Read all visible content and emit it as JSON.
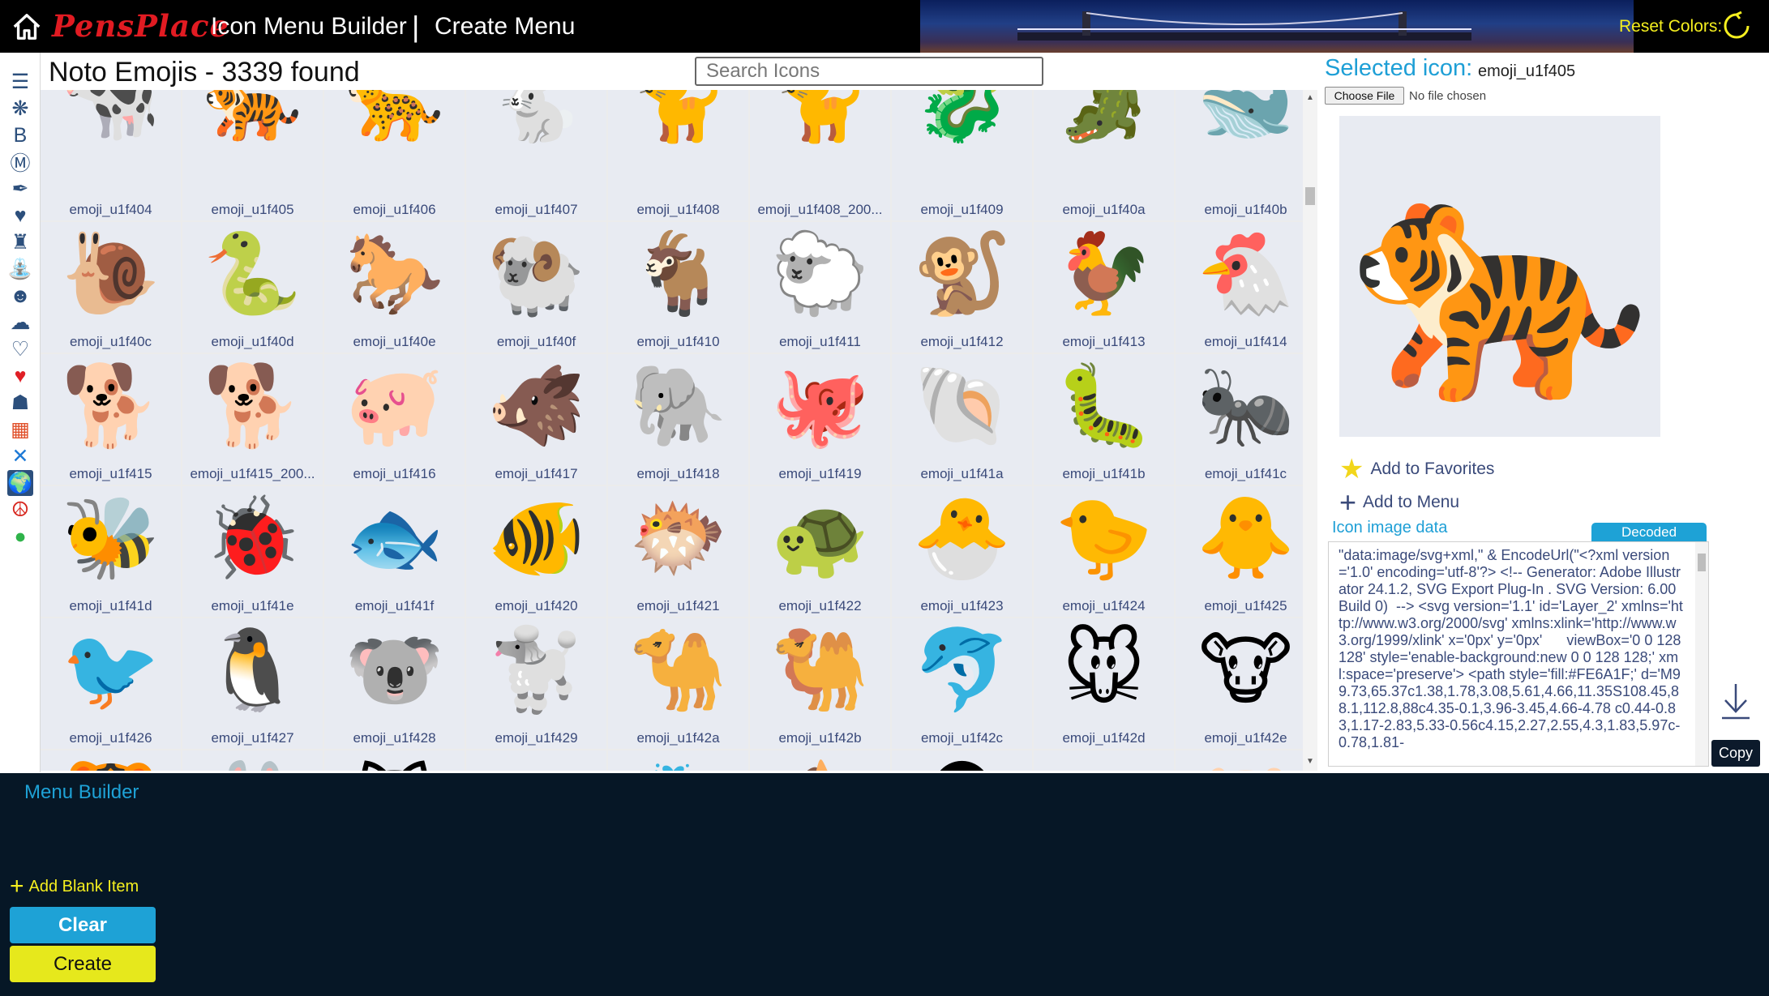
{
  "header": {
    "brand": "PensPlace",
    "app_title": "Icon Menu Builder",
    "separator": "|",
    "page_title": "Create Menu",
    "reset_colors": "Reset Colors:"
  },
  "leftbar": {
    "items": [
      {
        "icon": "menu-icon",
        "glyph": "☰",
        "color": "#2c4f7c"
      },
      {
        "icon": "brain-icon",
        "glyph": "❋",
        "color": "#2c4f7c"
      },
      {
        "icon": "bootstrap-icon",
        "glyph": "B",
        "color": "#2c4f7c"
      },
      {
        "icon": "material-icon",
        "glyph": "Ⓜ",
        "color": "#2c4f7c"
      },
      {
        "icon": "feather-icon",
        "glyph": "✒",
        "color": "#2c4f7c"
      },
      {
        "icon": "heart-outline-icon",
        "glyph": "♥",
        "color": "#2c4f7c"
      },
      {
        "icon": "castle-icon",
        "glyph": "♜",
        "color": "#2c4f7c"
      },
      {
        "icon": "fountain-icon",
        "glyph": "⛲",
        "color": "#2c4f7c"
      },
      {
        "icon": "cat-icon",
        "glyph": "☻",
        "color": "#2c4f7c"
      },
      {
        "icon": "weather-icon",
        "glyph": "☁",
        "color": "#2c4f7c"
      },
      {
        "icon": "pulse-icon",
        "glyph": "♡",
        "color": "#2c4f7c"
      },
      {
        "icon": "heart-red-icon",
        "glyph": "♥",
        "color": "#e01f26"
      },
      {
        "icon": "robot-icon",
        "glyph": "☗",
        "color": "#2c4f7c"
      },
      {
        "icon": "windows-icon",
        "glyph": "▦",
        "color": "#e0502a"
      },
      {
        "icon": "vscode-icon",
        "glyph": "✕",
        "color": "#1e7ad6"
      },
      {
        "icon": "globe-icon",
        "glyph": "🌍",
        "color": "#ffffff"
      },
      {
        "icon": "peace-icon",
        "glyph": "☮",
        "color": "#d7261e"
      },
      {
        "icon": "circle-color-icon",
        "glyph": "●",
        "color": "#2fb34a"
      }
    ]
  },
  "grid": {
    "title": "Noto Emojis - 3339 found",
    "search_placeholder": "Search Icons",
    "rows": [
      [
        {
          "emoji": "🐄",
          "label": "emoji_u1f404"
        },
        {
          "emoji": "🐅",
          "label": "emoji_u1f405"
        },
        {
          "emoji": "🐆",
          "label": "emoji_u1f406"
        },
        {
          "emoji": "🐇",
          "label": "emoji_u1f407"
        },
        {
          "emoji": "🐈",
          "label": "emoji_u1f408"
        },
        {
          "emoji": "🐈",
          "label": "emoji_u1f408_200..."
        },
        {
          "emoji": "🐉",
          "label": "emoji_u1f409"
        },
        {
          "emoji": "🐊",
          "label": "emoji_u1f40a"
        },
        {
          "emoji": "🐋",
          "label": "emoji_u1f40b"
        }
      ],
      [
        {
          "emoji": "🐌",
          "label": "emoji_u1f40c"
        },
        {
          "emoji": "🐍",
          "label": "emoji_u1f40d"
        },
        {
          "emoji": "🐎",
          "label": "emoji_u1f40e"
        },
        {
          "emoji": "🐏",
          "label": "emoji_u1f40f"
        },
        {
          "emoji": "🐐",
          "label": "emoji_u1f410"
        },
        {
          "emoji": "🐑",
          "label": "emoji_u1f411"
        },
        {
          "emoji": "🐒",
          "label": "emoji_u1f412"
        },
        {
          "emoji": "🐓",
          "label": "emoji_u1f413"
        },
        {
          "emoji": "🐔",
          "label": "emoji_u1f414"
        }
      ],
      [
        {
          "emoji": "🐕",
          "label": "emoji_u1f415"
        },
        {
          "emoji": "🐕",
          "label": "emoji_u1f415_200..."
        },
        {
          "emoji": "🐖",
          "label": "emoji_u1f416"
        },
        {
          "emoji": "🐗",
          "label": "emoji_u1f417"
        },
        {
          "emoji": "🐘",
          "label": "emoji_u1f418"
        },
        {
          "emoji": "🐙",
          "label": "emoji_u1f419"
        },
        {
          "emoji": "🐚",
          "label": "emoji_u1f41a"
        },
        {
          "emoji": "🐛",
          "label": "emoji_u1f41b"
        },
        {
          "emoji": "🐜",
          "label": "emoji_u1f41c"
        }
      ],
      [
        {
          "emoji": "🐝",
          "label": "emoji_u1f41d"
        },
        {
          "emoji": "🐞",
          "label": "emoji_u1f41e"
        },
        {
          "emoji": "🐟",
          "label": "emoji_u1f41f"
        },
        {
          "emoji": "🐠",
          "label": "emoji_u1f420"
        },
        {
          "emoji": "🐡",
          "label": "emoji_u1f421"
        },
        {
          "emoji": "🐢",
          "label": "emoji_u1f422"
        },
        {
          "emoji": "🐣",
          "label": "emoji_u1f423"
        },
        {
          "emoji": "🐤",
          "label": "emoji_u1f424"
        },
        {
          "emoji": "🐥",
          "label": "emoji_u1f425"
        }
      ],
      [
        {
          "emoji": "🐦",
          "label": "emoji_u1f426"
        },
        {
          "emoji": "🐧",
          "label": "emoji_u1f427"
        },
        {
          "emoji": "🐨",
          "label": "emoji_u1f428"
        },
        {
          "emoji": "🐩",
          "label": "emoji_u1f429"
        },
        {
          "emoji": "🐪",
          "label": "emoji_u1f42a"
        },
        {
          "emoji": "🐫",
          "label": "emoji_u1f42b"
        },
        {
          "emoji": "🐬",
          "label": "emoji_u1f42c"
        },
        {
          "emoji": "🐭",
          "label": "emoji_u1f42d"
        },
        {
          "emoji": "🐮",
          "label": "emoji_u1f42e"
        }
      ],
      [
        {
          "emoji": "🐯",
          "label": ""
        },
        {
          "emoji": "🐰",
          "label": ""
        },
        {
          "emoji": "🐱",
          "label": ""
        },
        {
          "emoji": "🐲",
          "label": ""
        },
        {
          "emoji": "🐳",
          "label": ""
        },
        {
          "emoji": "🐴",
          "label": ""
        },
        {
          "emoji": "🐵",
          "label": ""
        },
        {
          "emoji": "🐶",
          "label": ""
        },
        {
          "emoji": "🐷",
          "label": ""
        }
      ]
    ]
  },
  "selected": {
    "title": "Selected icon:",
    "name": "emoji_u1f405",
    "choose_file": "Choose File",
    "no_file": "No file chosen",
    "preview_emoji": "🐅",
    "add_favorites": "Add to Favorites",
    "add_menu": "Add to Menu",
    "image_data_title": "Icon image data",
    "decoded_tab": "Decoded",
    "image_data": "\"data:image/svg+xml,\" & EncodeUrl(\"<?xml version='1.0' encoding='utf-8'?> <!-- Generator: Adobe Illustrator 24.1.2, SVG Export Plug-In . SVG Version: 6.00 Build 0)  --> <svg version='1.1' id='Layer_2' xmlns='http://www.w3.org/2000/svg' xmlns:xlink='http://www.w3.org/1999/xlink' x='0px' y='0px'      viewBox='0 0 128 128' style='enable-background:new 0 0 128 128;' xml:space='preserve'> <path style='fill:#FE6A1F;' d='M99.73,65.37c1.38,1.78,3.08,5.61,4.66,11.35S108.45,88.1,112.8,88c4.35-0.1,3.96-3.45,4.66-4.78 c0.44-0.83,1.17-2.83,5.33-0.56c4.15,2.27,2.55,4.3,1.83,5.97c-0.78,1.81-",
    "copy": "Copy"
  },
  "builder": {
    "title": "Menu Builder",
    "add_blank": "Add Blank Item",
    "clear": "Clear",
    "create": "Create"
  },
  "colors": {
    "accent": "#1ea2d6",
    "brand_red": "#e11b22",
    "yellow": "#f5ef1f",
    "navy": "#061726"
  }
}
